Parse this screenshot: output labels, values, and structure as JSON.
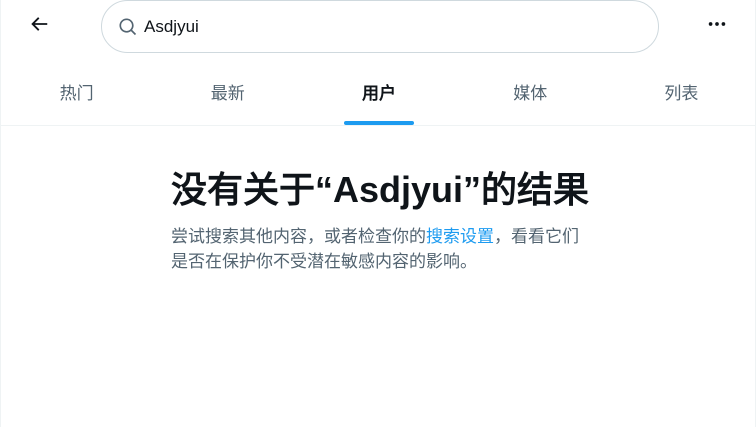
{
  "search": {
    "value": "Asdjyui"
  },
  "tabs": [
    {
      "label": "热门",
      "active": false
    },
    {
      "label": "最新",
      "active": false
    },
    {
      "label": "用户",
      "active": true
    },
    {
      "label": "媒体",
      "active": false
    },
    {
      "label": "列表",
      "active": false
    }
  ],
  "empty_state": {
    "title": "没有关于“Asdjyui”的结果",
    "desc_prefix": "尝试搜索其他内容，或者检查你的",
    "desc_link": "搜索设置",
    "desc_suffix": "，看看它们是否在保护你不受潜在敏感内容的影响。"
  },
  "colors": {
    "accent": "#1d9bf0",
    "text_primary": "#0f1419",
    "text_secondary": "#536471",
    "border": "#cfd9de"
  },
  "icons": {
    "back": "arrow-left-icon",
    "search": "search-icon",
    "more": "more-horizontal-icon"
  }
}
